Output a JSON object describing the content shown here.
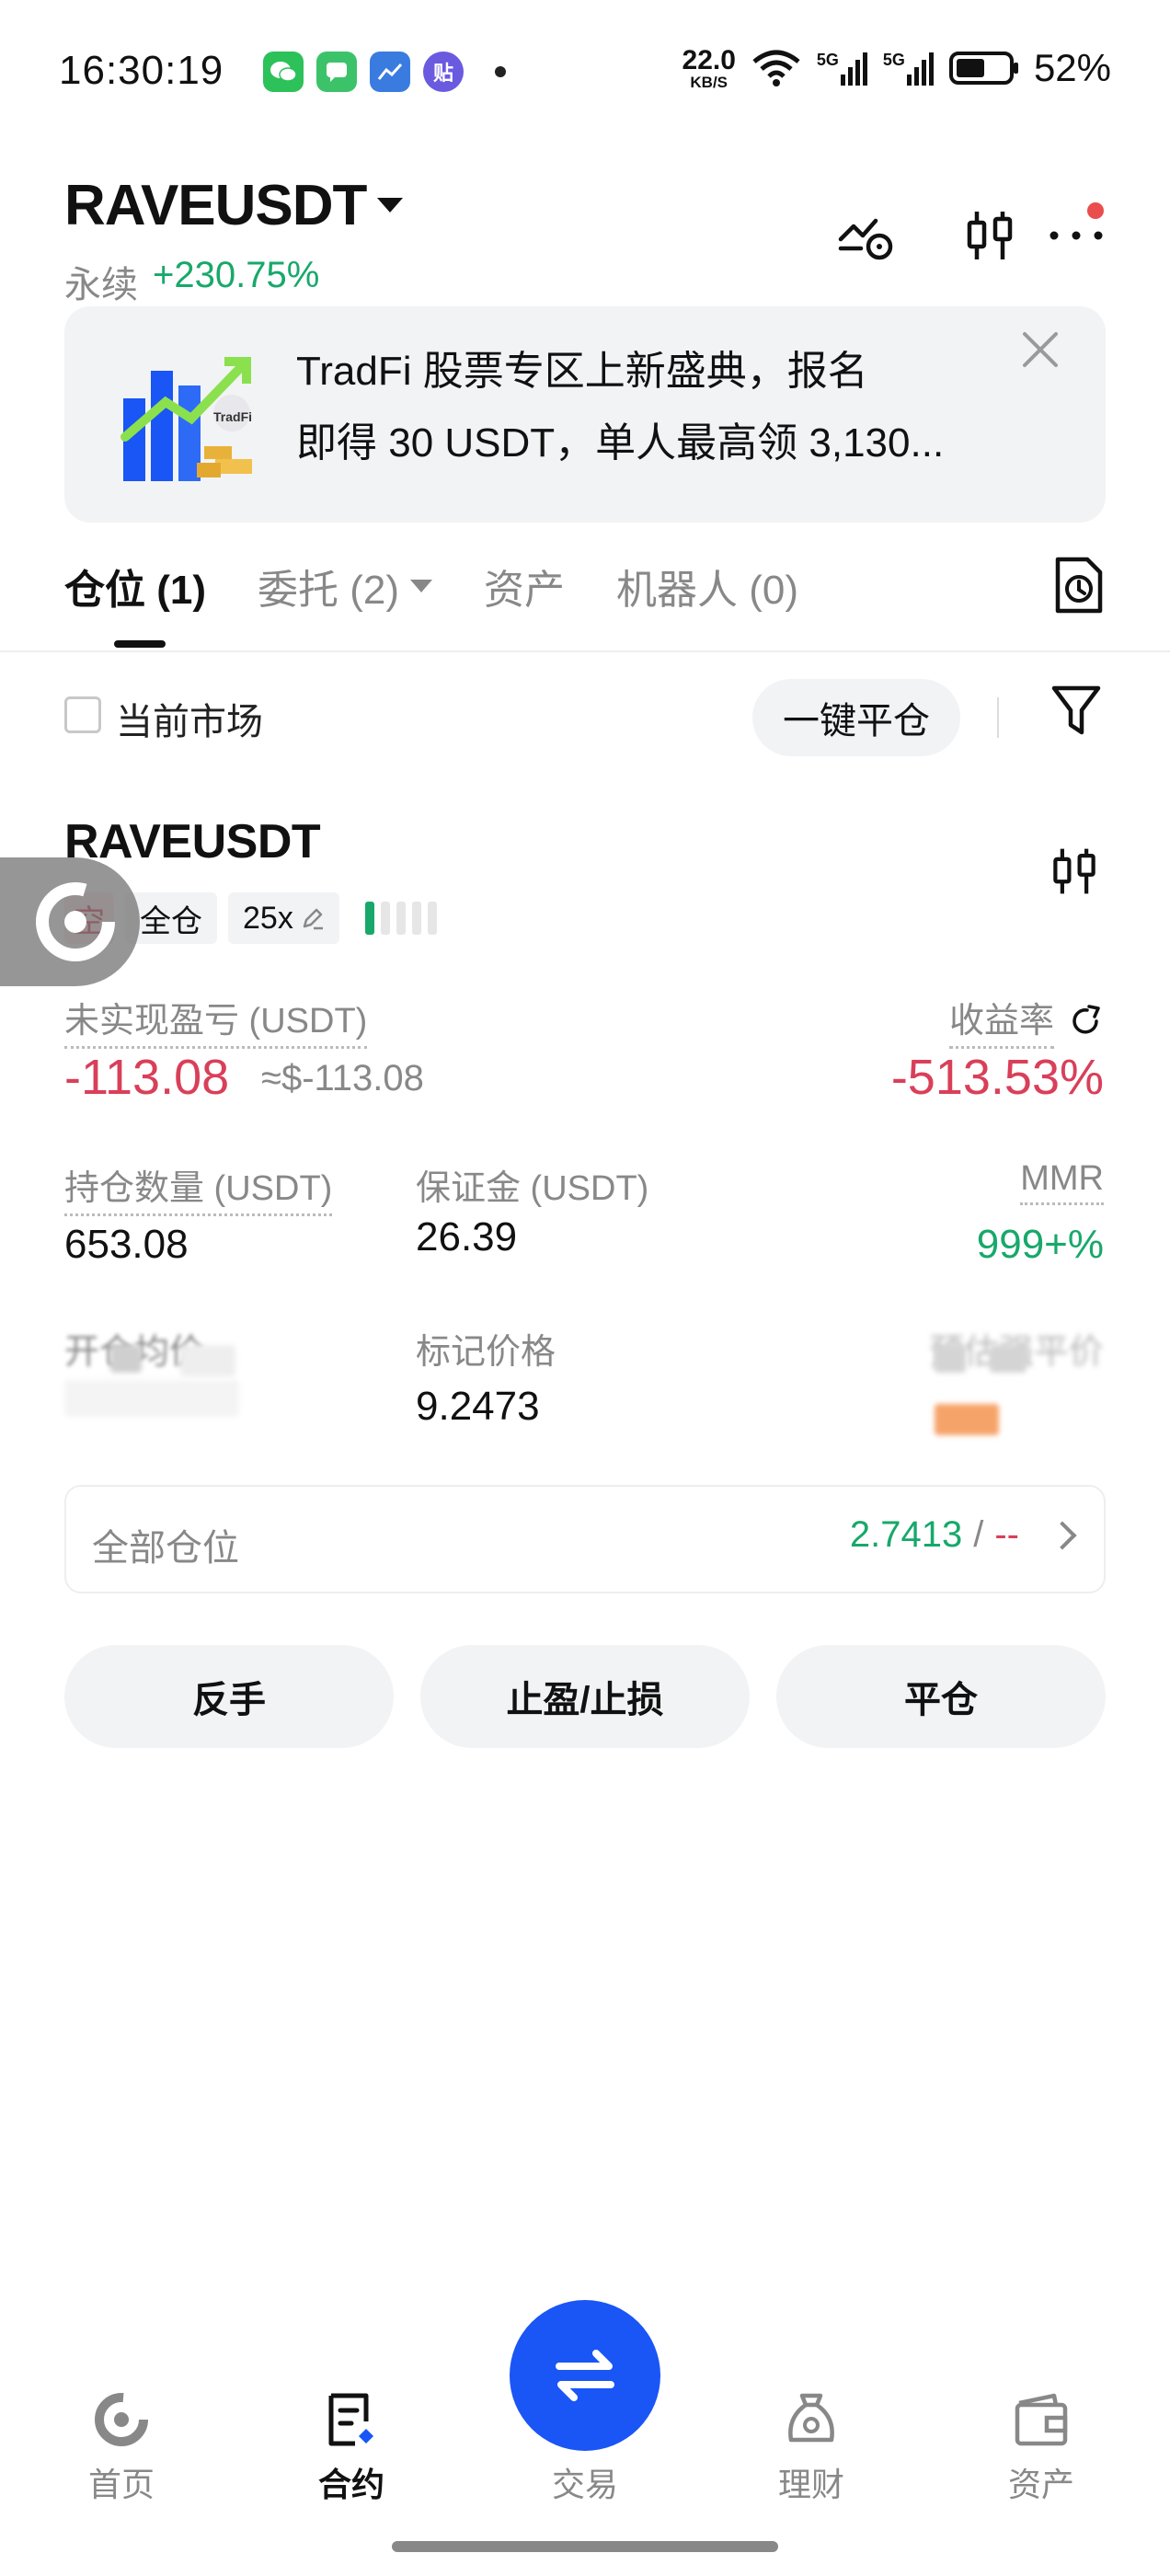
{
  "status_bar": {
    "time": "16:30:19",
    "net_speed_value": "22.0",
    "net_speed_unit": "KB/S",
    "signal_1": "5G",
    "signal_2": "5G",
    "battery": "52%",
    "app_icon_tie": "贴"
  },
  "header": {
    "pair": "RAVEUSDT",
    "contract_type": "永续",
    "change": "+230.75%"
  },
  "banner": {
    "badge": "TradFi",
    "line1": "TradFi 股票专区上新盛典，报名",
    "line2": "即得 30 USDT，单人最高领 3,130..."
  },
  "tabs": [
    {
      "label": "仓位 (1)"
    },
    {
      "label": "委托 (2)"
    },
    {
      "label": "资产"
    },
    {
      "label": "机器人 (0)"
    }
  ],
  "filter": {
    "current_market": "当前市场",
    "close_all": "一键平仓"
  },
  "position": {
    "symbol": "RAVEUSDT",
    "side": "空",
    "margin_mode": "全仓",
    "leverage": "25x",
    "upnl_label": "未实现盈亏 (USDT)",
    "upnl_value": "-113.08",
    "upnl_usd": "≈$-113.08",
    "roe_label": "收益率",
    "roe_value": "-513.53%",
    "size_label": "持仓数量 (USDT)",
    "size_value": "653.08",
    "margin_label": "保证金 (USDT)",
    "margin_value": "26.39",
    "mmr_label": "MMR",
    "mmr_value": "999+%",
    "entry_label": "开仓均价",
    "mark_label": "标记价格",
    "mark_value": "9.2473",
    "liq_label": "预估强平价"
  },
  "all_positions": {
    "label": "全部仓位",
    "price": "2.7413",
    "sep": "/",
    "liq": "--"
  },
  "actions": {
    "reverse": "反手",
    "tpsl": "止盈/止损",
    "close": "平仓"
  },
  "bottom_nav": {
    "home": "首页",
    "futures": "合约",
    "trade": "交易",
    "earn": "理财",
    "assets": "资产"
  },
  "colors": {
    "accent": "#1a55f5",
    "green": "#18a86b",
    "red": "#d93f59"
  }
}
